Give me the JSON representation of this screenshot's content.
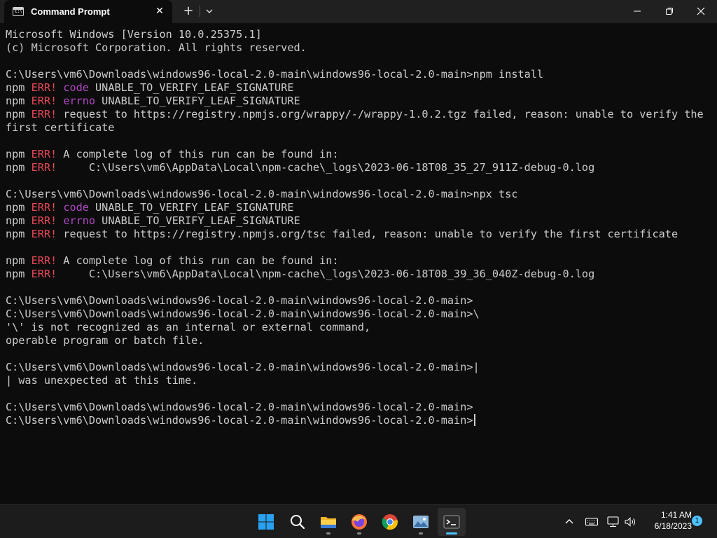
{
  "titlebar": {
    "tab_title": "Command Prompt",
    "tab_icon": "cmd-icon",
    "tab_close_glyph": "✕",
    "new_tab_glyph": "+",
    "dropdown_icon": "chevron-down-icon",
    "window_buttons": [
      "minimize-icon",
      "maximize-icon",
      "close-icon"
    ]
  },
  "terminal": {
    "lines": [
      {
        "segments": [
          {
            "t": "Microsoft Windows [Version 10.0.25375.1]"
          }
        ]
      },
      {
        "segments": [
          {
            "t": "(c) Microsoft Corporation. All rights reserved."
          }
        ]
      },
      {
        "segments": [
          {
            "t": ""
          }
        ]
      },
      {
        "segments": [
          {
            "t": "C:\\Users\\vm6\\Downloads\\windows96-local-2.0-main\\windows96-local-2.0-main>npm install"
          }
        ]
      },
      {
        "segments": [
          {
            "t": "npm "
          },
          {
            "t": "ERR!",
            "c": "err"
          },
          {
            "t": " "
          },
          {
            "t": "code",
            "c": "kw"
          },
          {
            "t": " UNABLE_TO_VERIFY_LEAF_SIGNATURE"
          }
        ]
      },
      {
        "segments": [
          {
            "t": "npm "
          },
          {
            "t": "ERR!",
            "c": "err"
          },
          {
            "t": " "
          },
          {
            "t": "errno",
            "c": "kw"
          },
          {
            "t": " UNABLE_TO_VERIFY_LEAF_SIGNATURE"
          }
        ]
      },
      {
        "segments": [
          {
            "t": "npm "
          },
          {
            "t": "ERR!",
            "c": "err"
          },
          {
            "t": " request to https://registry.npmjs.org/wrappy/-/wrappy-1.0.2.tgz failed, reason: unable to verify the"
          }
        ]
      },
      {
        "segments": [
          {
            "t": "first certificate"
          }
        ]
      },
      {
        "segments": [
          {
            "t": ""
          }
        ]
      },
      {
        "segments": [
          {
            "t": "npm "
          },
          {
            "t": "ERR!",
            "c": "err"
          },
          {
            "t": " A complete log of this run can be found in:"
          }
        ]
      },
      {
        "segments": [
          {
            "t": "npm "
          },
          {
            "t": "ERR!",
            "c": "err"
          },
          {
            "t": "     C:\\Users\\vm6\\AppData\\Local\\npm-cache\\_logs\\2023-06-18T08_35_27_911Z-debug-0.log"
          }
        ]
      },
      {
        "segments": [
          {
            "t": ""
          }
        ]
      },
      {
        "segments": [
          {
            "t": "C:\\Users\\vm6\\Downloads\\windows96-local-2.0-main\\windows96-local-2.0-main>npx tsc"
          }
        ]
      },
      {
        "segments": [
          {
            "t": "npm "
          },
          {
            "t": "ERR!",
            "c": "err"
          },
          {
            "t": " "
          },
          {
            "t": "code",
            "c": "kw"
          },
          {
            "t": " UNABLE_TO_VERIFY_LEAF_SIGNATURE"
          }
        ]
      },
      {
        "segments": [
          {
            "t": "npm "
          },
          {
            "t": "ERR!",
            "c": "err"
          },
          {
            "t": " "
          },
          {
            "t": "errno",
            "c": "kw"
          },
          {
            "t": " UNABLE_TO_VERIFY_LEAF_SIGNATURE"
          }
        ]
      },
      {
        "segments": [
          {
            "t": "npm "
          },
          {
            "t": "ERR!",
            "c": "err"
          },
          {
            "t": " request to https://registry.npmjs.org/tsc failed, reason: unable to verify the first certificate"
          }
        ]
      },
      {
        "segments": [
          {
            "t": ""
          }
        ]
      },
      {
        "segments": [
          {
            "t": "npm "
          },
          {
            "t": "ERR!",
            "c": "err"
          },
          {
            "t": " A complete log of this run can be found in:"
          }
        ]
      },
      {
        "segments": [
          {
            "t": "npm "
          },
          {
            "t": "ERR!",
            "c": "err"
          },
          {
            "t": "     C:\\Users\\vm6\\AppData\\Local\\npm-cache\\_logs\\2023-06-18T08_39_36_040Z-debug-0.log"
          }
        ]
      },
      {
        "segments": [
          {
            "t": ""
          }
        ]
      },
      {
        "segments": [
          {
            "t": "C:\\Users\\vm6\\Downloads\\windows96-local-2.0-main\\windows96-local-2.0-main>"
          }
        ]
      },
      {
        "segments": [
          {
            "t": "C:\\Users\\vm6\\Downloads\\windows96-local-2.0-main\\windows96-local-2.0-main>\\"
          }
        ]
      },
      {
        "segments": [
          {
            "t": "'\\' is not recognized as an internal or external command,"
          }
        ]
      },
      {
        "segments": [
          {
            "t": "operable program or batch file."
          }
        ]
      },
      {
        "segments": [
          {
            "t": ""
          }
        ]
      },
      {
        "segments": [
          {
            "t": "C:\\Users\\vm6\\Downloads\\windows96-local-2.0-main\\windows96-local-2.0-main>|"
          }
        ]
      },
      {
        "segments": [
          {
            "t": "| was unexpected at this time."
          }
        ]
      },
      {
        "segments": [
          {
            "t": ""
          }
        ]
      },
      {
        "segments": [
          {
            "t": "C:\\Users\\vm6\\Downloads\\windows96-local-2.0-main\\windows96-local-2.0-main>"
          }
        ]
      },
      {
        "segments": [
          {
            "t": "C:\\Users\\vm6\\Downloads\\windows96-local-2.0-main\\windows96-local-2.0-main>"
          }
        ],
        "cursor": true
      }
    ],
    "colors": {
      "text": "#cccccc",
      "error": "#e74856",
      "keyword": "#b148c6",
      "background": "#0c0c0c"
    }
  },
  "taskbar": {
    "apps": [
      {
        "name": "start-button",
        "icon": "windows-logo-icon"
      },
      {
        "name": "search-button",
        "icon": "search-icon"
      },
      {
        "name": "file-explorer-button",
        "icon": "folder-icon"
      },
      {
        "name": "firefox-button",
        "icon": "firefox-icon"
      },
      {
        "name": "chrome-button",
        "icon": "chrome-icon"
      },
      {
        "name": "photos-button",
        "icon": "photos-icon"
      },
      {
        "name": "terminal-button",
        "icon": "terminal-icon",
        "active": true
      }
    ],
    "tray": [
      "chevron-up-icon",
      "keyboard-icon",
      "network-icon",
      "volume-icon"
    ],
    "time": "1:41 AM",
    "date": "6/18/2023",
    "notification_count": "1"
  }
}
